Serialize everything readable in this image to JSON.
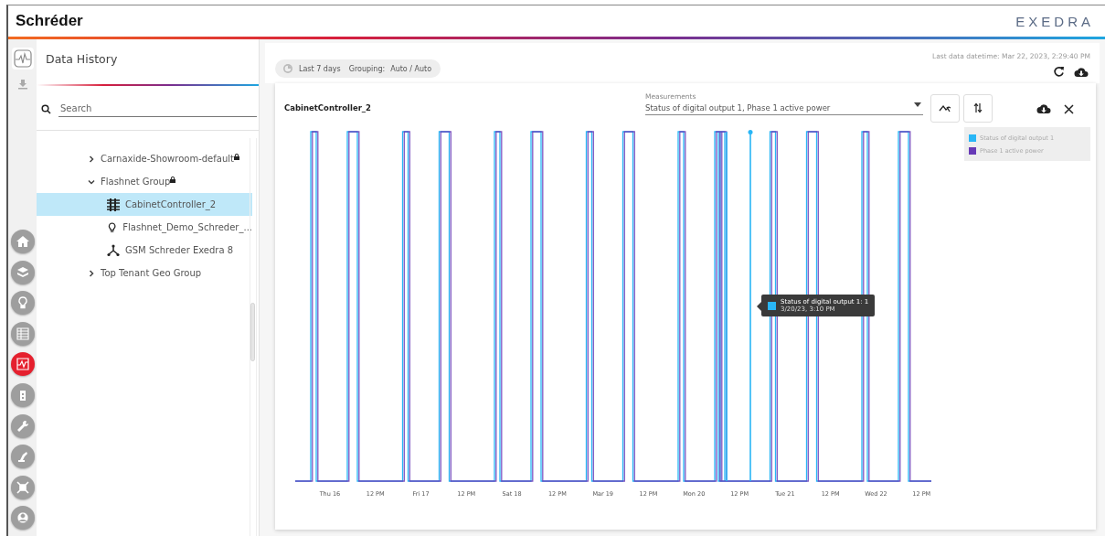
{
  "header": {
    "brand": "Schréder",
    "product": "EXEDRA"
  },
  "tools": [
    {
      "selected": true
    },
    {
      "selected": false
    }
  ],
  "rail": [
    {
      "selected": false
    },
    {
      "selected": false
    },
    {
      "selected": false
    },
    {
      "selected": false
    },
    {
      "selected": true
    },
    {
      "selected": false
    },
    {
      "selected": false
    },
    {
      "selected": false
    },
    {
      "selected": false
    },
    {
      "selected": false
    }
  ],
  "panel": {
    "title": "Data History",
    "search": {
      "placeholder": "Search"
    },
    "tree": [
      {
        "label": "Carnaxide-Showroom-default",
        "locked": true,
        "expanded": false,
        "selected": false
      },
      {
        "label": "Flashnet Group",
        "locked": true,
        "expanded": true,
        "selected": false,
        "children": [
          {
            "label": "CabinetController_2",
            "kind": "cabinet",
            "selected": true
          },
          {
            "label": "Flashnet_Demo_Schreder_...",
            "kind": "lamp",
            "selected": false
          },
          {
            "label": "GSM Schreder Exedra 8",
            "kind": "gateway",
            "selected": false
          }
        ]
      },
      {
        "label": "Top Tenant Geo Group",
        "locked": false,
        "expanded": false,
        "selected": false
      }
    ]
  },
  "toolbar": {
    "range": "Last 7 days",
    "grouping_label": "Grouping:",
    "grouping": "Auto / Auto",
    "last_data": "Last data datetime: Mar 22, 2023, 2:29:40 PM"
  },
  "card": {
    "title": "CabinetController_2",
    "measurements": {
      "label": "Measurements",
      "value": "Status of digital output 1, Phase 1 active power"
    },
    "legend": [
      {
        "label": "Status of digital output 1",
        "color": "#29b6f6"
      },
      {
        "label": "Phase 1 active power",
        "color": "#673ab7"
      }
    ],
    "x_labels": [
      "Thu 16",
      "12 PM",
      "Fri 17",
      "12 PM",
      "Sat 18",
      "12 PM",
      "Mar 19",
      "12 PM",
      "Mon 20",
      "12 PM",
      "Tue 21",
      "12 PM",
      "Wed 22",
      "12 PM"
    ],
    "tooltip": {
      "title": "Status of digital output 1: 1",
      "time": "3/20/23, 3:10 PM"
    }
  }
}
